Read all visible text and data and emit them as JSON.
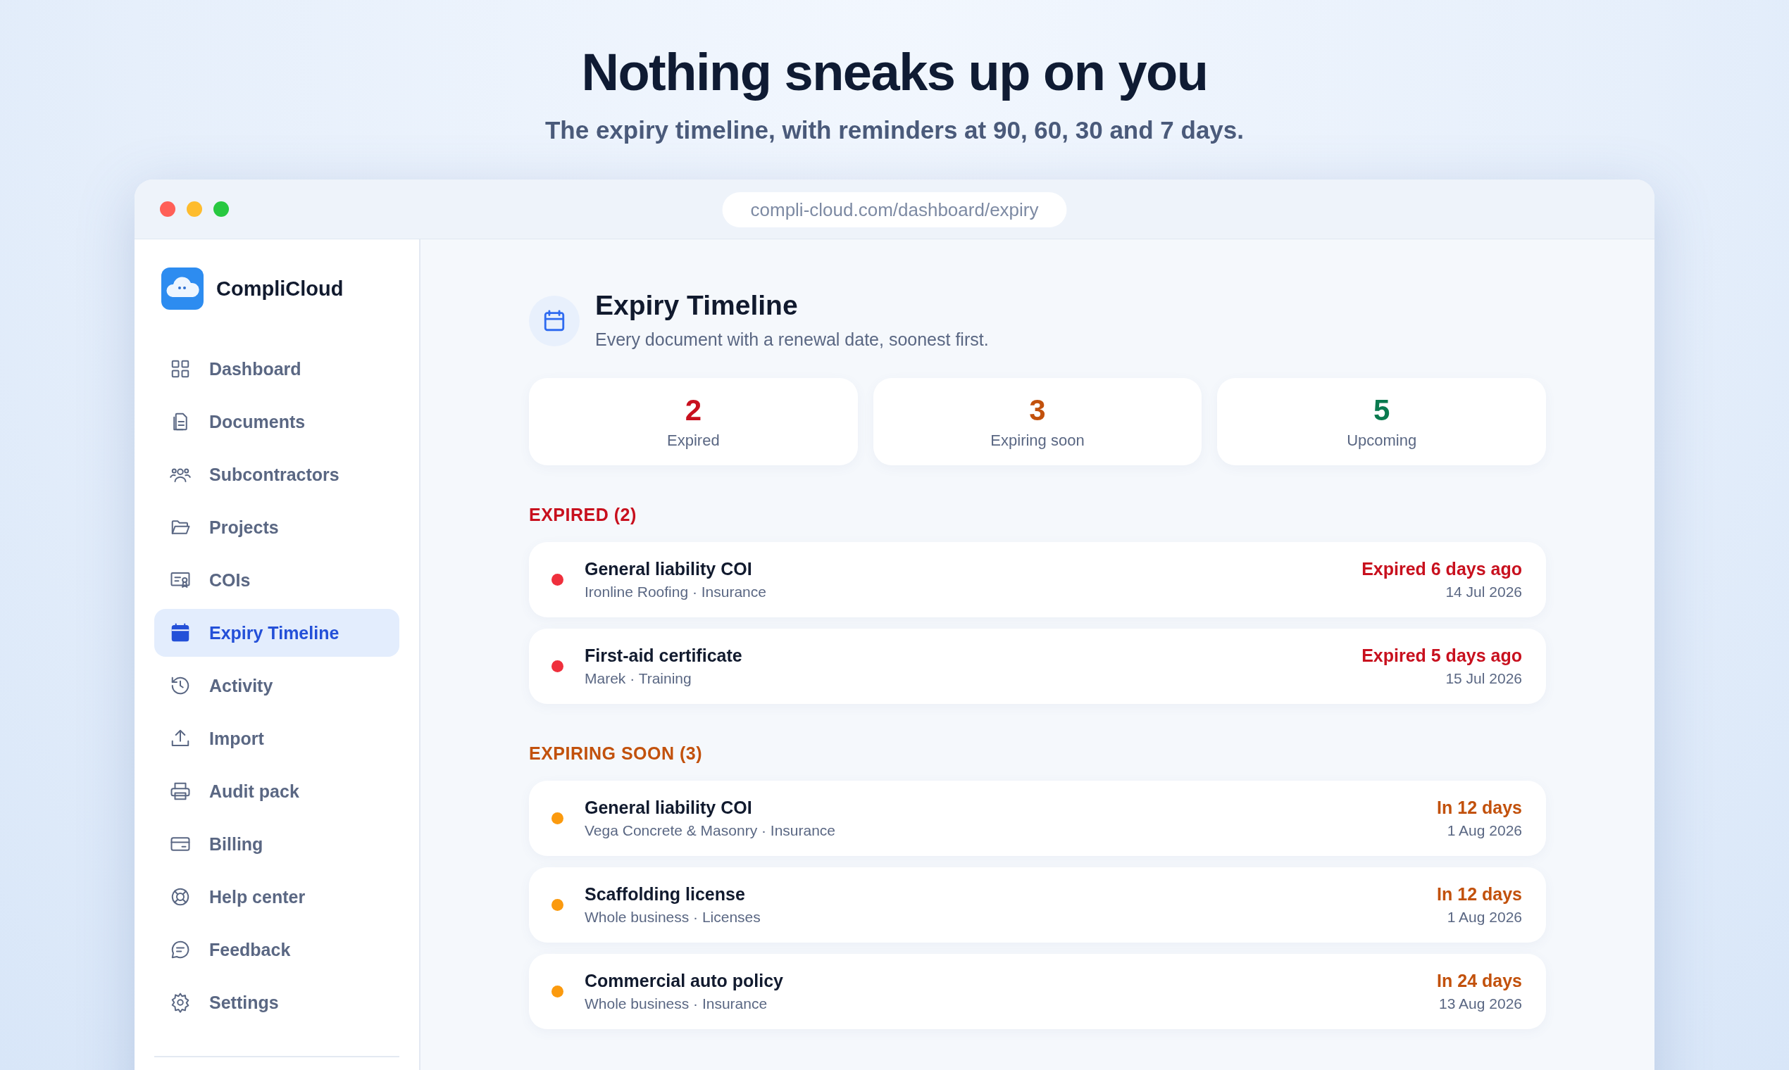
{
  "hero": {
    "title": "Nothing sneaks up on you",
    "subtitle": "The expiry timeline, with reminders at 90, 60, 30 and 7 days."
  },
  "window": {
    "url": "compli-cloud.com/dashboard/expiry"
  },
  "sidebar": {
    "brand": "CompliCloud",
    "items": [
      {
        "label": "Dashboard",
        "selected": false
      },
      {
        "label": "Documents",
        "selected": false
      },
      {
        "label": "Subcontractors",
        "selected": false
      },
      {
        "label": "Projects",
        "selected": false
      },
      {
        "label": "COIs",
        "selected": false
      },
      {
        "label": "Expiry Timeline",
        "selected": true
      },
      {
        "label": "Activity",
        "selected": false
      },
      {
        "label": "Import",
        "selected": false
      },
      {
        "label": "Audit pack",
        "selected": false
      },
      {
        "label": "Billing",
        "selected": false
      },
      {
        "label": "Help center",
        "selected": false
      },
      {
        "label": "Feedback",
        "selected": false
      },
      {
        "label": "Settings",
        "selected": false
      }
    ]
  },
  "page": {
    "title": "Expiry Timeline",
    "subtitle": "Every document with a renewal date, soonest first."
  },
  "stats": [
    {
      "value": "2",
      "label": "Expired",
      "color": "#c8101e"
    },
    {
      "value": "3",
      "label": "Expiring soon",
      "color": "#c2510c"
    },
    {
      "value": "5",
      "label": "Upcoming",
      "color": "#0a7a4f"
    }
  ],
  "sections": [
    {
      "heading": "EXPIRED (2)",
      "kind": "expired",
      "rows": [
        {
          "title": "General liability COI",
          "meta": "Ironline Roofing · Insurance",
          "status": "Expired 6 days ago",
          "date": "14 Jul 2026",
          "color": "#ef2f3c"
        },
        {
          "title": "First-aid certificate",
          "meta": "Marek · Training",
          "status": "Expired 5 days ago",
          "date": "15 Jul 2026",
          "color": "#ef2f3c"
        }
      ]
    },
    {
      "heading": "EXPIRING SOON (3)",
      "kind": "soon",
      "rows": [
        {
          "title": "General liability COI",
          "meta": "Vega Concrete & Masonry · Insurance",
          "status": "In 12 days",
          "date": "1 Aug 2026",
          "color": "#fb9a0e"
        },
        {
          "title": "Scaffolding license",
          "meta": "Whole business · Licenses",
          "status": "In 12 days",
          "date": "1 Aug 2026",
          "color": "#fb9a0e"
        },
        {
          "title": "Commercial auto policy",
          "meta": "Whole business · Insurance",
          "status": "In 24 days",
          "date": "13 Aug 2026",
          "color": "#fb9a0e"
        }
      ]
    }
  ]
}
